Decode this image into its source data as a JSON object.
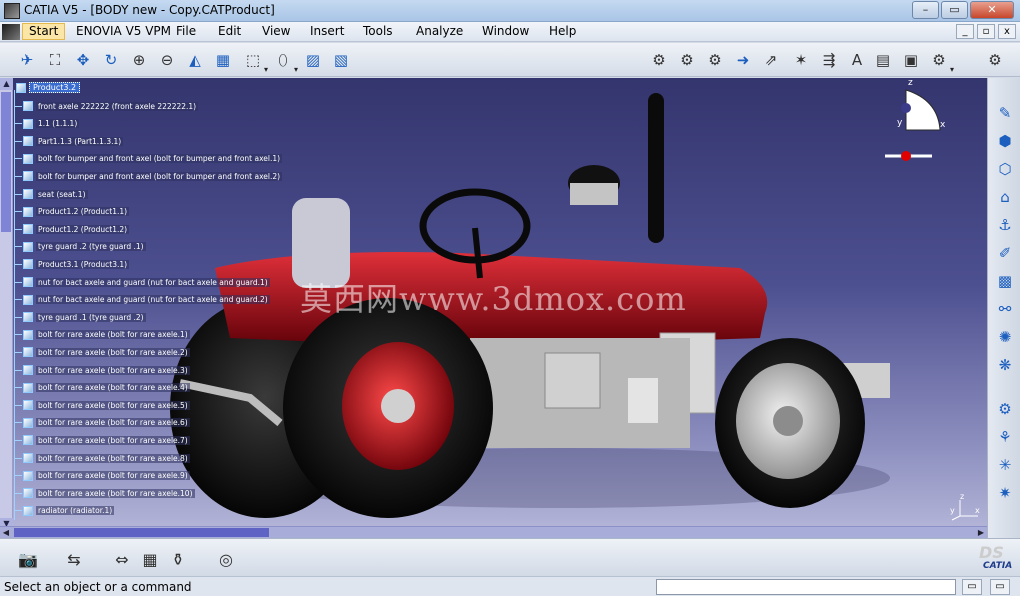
{
  "window": {
    "title": "CATIA V5 - [BODY new - Copy.CATProduct]",
    "minimize": "–",
    "maximize": "▭",
    "close": "✕"
  },
  "menu": {
    "items": [
      "Start",
      "ENOVIA V5 VPM",
      "File",
      "Edit",
      "View",
      "Insert",
      "Tools",
      "Analyze",
      "Window",
      "Help"
    ],
    "mdi": [
      "_",
      "▫",
      "x"
    ]
  },
  "tree": {
    "root": "Product3.2",
    "nodes": [
      "front axele 222222 (front axele 222222.1)",
      "1.1 (1.1.1)",
      "Part1.1.3 (Part1.1.3.1)",
      "bolt for bumper and front axel (bolt for bumper and front axel.1)",
      "bolt for bumper and front axel (bolt for bumper and front axel.2)",
      "seat (seat.1)",
      "Product1.2 (Product1.1)",
      "Product1.2 (Product1.2)",
      "tyre guard .2 (tyre guard .1)",
      "Product3.1 (Product3.1)",
      "nut for bact axele and guard (nut for bact axele and guard.1)",
      "nut for bact axele and guard (nut for bact axele and guard.2)",
      "tyre guard .1 (tyre guard .2)",
      "bolt for rare axele (bolt for rare axele.1)",
      "bolt for rare axele (bolt for rare axele.2)",
      "bolt for rare axele (bolt for rare axele.3)",
      "bolt for rare axele (bolt for rare axele.4)",
      "bolt for rare axele (bolt for rare axele.5)",
      "bolt for rare axele (bolt for rare axele.6)",
      "bolt for rare axele (bolt for rare axele.7)",
      "bolt for rare axele (bolt for rare axele.8)",
      "bolt for rare axele (bolt for rare axele.9)",
      "bolt for rare axele (bolt for rare axele.10)",
      "radiator (radiator.1)"
    ]
  },
  "viewport": {
    "watermark": "莫西网www.3dmox.com",
    "compass_labels": {
      "z": "z",
      "x": "x",
      "y": "y"
    },
    "mini_axes": {
      "z": "z",
      "x": "x",
      "y": "y"
    }
  },
  "scroll": {
    "up": "▲",
    "down": "▼",
    "left": "◀",
    "right": "▶"
  },
  "logo": {
    "ds": "DS",
    "brand": "CATIA"
  },
  "status": {
    "message": "Select an object or a command"
  },
  "colors": {
    "tractor_body": "#a3101c",
    "viewport_top": "#34356e",
    "viewport_bottom": "#b7b8da"
  }
}
